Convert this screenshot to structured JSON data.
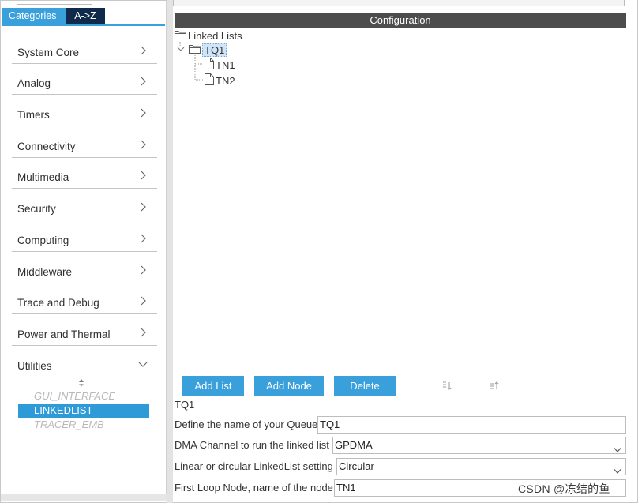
{
  "sidebar": {
    "tabs": [
      {
        "label": "Categories",
        "active": true
      },
      {
        "label": "A->Z",
        "active": false
      }
    ],
    "categories": [
      {
        "label": "System Core",
        "expanded": false
      },
      {
        "label": "Analog",
        "expanded": false
      },
      {
        "label": "Timers",
        "expanded": false
      },
      {
        "label": "Connectivity",
        "expanded": false
      },
      {
        "label": "Multimedia",
        "expanded": false
      },
      {
        "label": "Security",
        "expanded": false
      },
      {
        "label": "Computing",
        "expanded": false
      },
      {
        "label": "Middleware",
        "expanded": false
      },
      {
        "label": "Trace and Debug",
        "expanded": false
      },
      {
        "label": "Power and Thermal",
        "expanded": false
      },
      {
        "label": "Utilities",
        "expanded": true
      }
    ],
    "utilities_items": [
      {
        "label": "GUI_INTERFACE",
        "state": "disabled"
      },
      {
        "label": "LINKEDLIST",
        "state": "selected"
      },
      {
        "label": "TRACER_EMB",
        "state": "disabled"
      }
    ],
    "sort_icon": "sort-updown-icon"
  },
  "config": {
    "header": "Configuration",
    "tree": {
      "root": "Linked Lists",
      "queue": "TQ1",
      "nodes": [
        "TN1",
        "TN2"
      ]
    },
    "buttons": {
      "add_list": "Add List",
      "add_node": "Add Node",
      "delete": "Delete"
    },
    "selected_title": "TQ1",
    "form": {
      "queue_name": {
        "label": "Define the name of your Queue",
        "value": "TQ1"
      },
      "dma_channel": {
        "label": "DMA Channel to run the linked list",
        "value": "GPDMA"
      },
      "list_type": {
        "label": "Linear or circular LinkedList setting",
        "value": "Circular"
      },
      "first_loop_node": {
        "label": "First Loop Node, name of the node",
        "value": "TN1"
      }
    }
  },
  "watermark": "CSDN @冻结的鱼",
  "colors": {
    "accent": "#3aa0dc",
    "tab_dark": "#0f2a4a",
    "header": "#4d4d4d",
    "selection": "#2e9bd8"
  }
}
